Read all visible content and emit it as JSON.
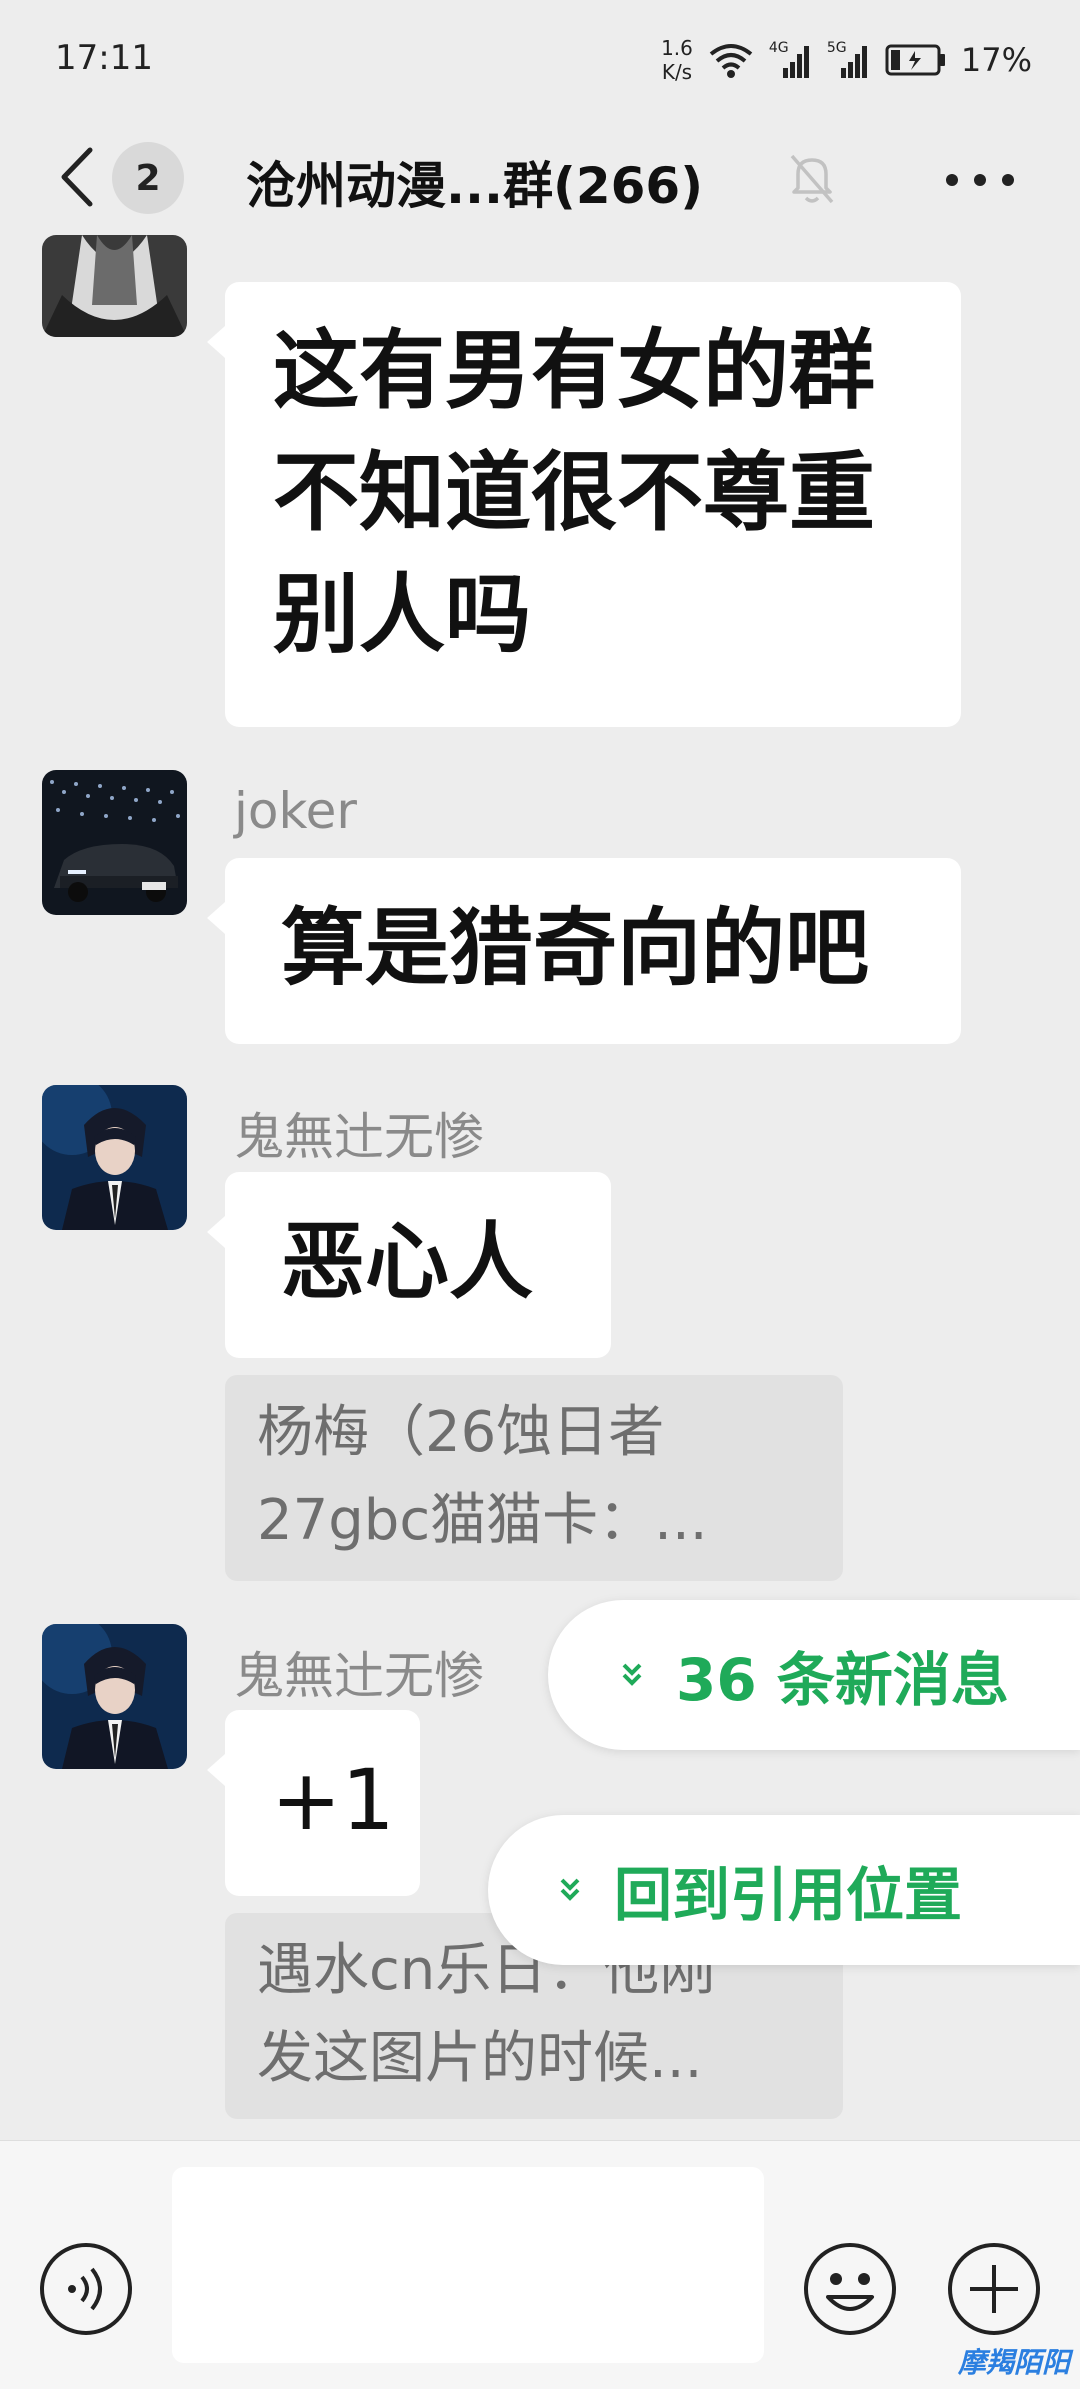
{
  "status_bar": {
    "time": "17:11",
    "net_speed_value": "1.6",
    "net_speed_unit": "K/s",
    "network_1": "4G",
    "network_2": "5G",
    "battery": "17%"
  },
  "header": {
    "badge_count": "2",
    "title": "沧州动漫...群(266)"
  },
  "messages": [
    {
      "sender": "",
      "text": "这有男有女的群\n不知道很不尊重\n别人吗"
    },
    {
      "sender": "joker",
      "text": "算是猎奇向的吧"
    },
    {
      "sender": "鬼無辻无惨",
      "text": "恶心人",
      "quote": "杨梅（26蚀日者\n27gbc猫猫卡：..."
    },
    {
      "sender": "鬼無辻无惨",
      "text": "+1",
      "quote": "遇水cn乐日：他刚\n发这图片的时候..."
    }
  ],
  "floating": {
    "new_messages": "36 条新消息",
    "back_to_quote": "回到引用位置"
  },
  "watermark": "摩羯陌阳",
  "icons": {
    "back": "chevron-left-icon",
    "mute": "bell-off-icon",
    "more": "more-dots-icon",
    "voice": "voice-icon",
    "emoji": "emoji-icon",
    "plus": "plus-icon",
    "accent_green": "#1faa59"
  }
}
